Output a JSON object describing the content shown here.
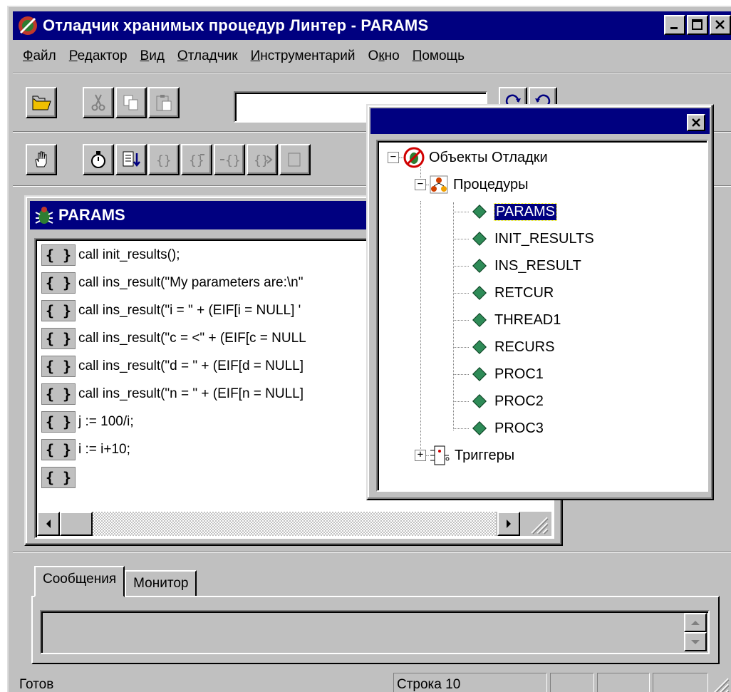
{
  "window": {
    "title": "Отладчик хранимых процедур Линтер - PARAMS",
    "minimize_label": "_",
    "maximize_label": "□",
    "close_label": "×"
  },
  "menu": [
    {
      "label": "Файл",
      "hotkey": "Ф",
      "rest": "айл"
    },
    {
      "label": "Редактор",
      "hotkey": "Р",
      "rest": "едактор"
    },
    {
      "label": "Вид",
      "hotkey": "В",
      "rest": "ид"
    },
    {
      "label": "Отладчик",
      "hotkey": "О",
      "rest": "тладчик"
    },
    {
      "label": "Инструментарий",
      "hotkey": "И",
      "rest": "нструментарий"
    },
    {
      "label": "Окно",
      "pre": "О",
      "hotkey": "к",
      "rest": "но"
    },
    {
      "label": "Помощь",
      "hotkey": "П",
      "rest": "омощь"
    }
  ],
  "toolbar": {
    "combo_value": "",
    "row1_icons": [
      "open-folder-icon",
      "cut-icon",
      "copy-icon",
      "paste-icon",
      "redo-icon",
      "undo-icon"
    ],
    "row2_icons": [
      "hand-icon",
      "stopwatch-icon",
      "list-down-icon",
      "step-into-icon",
      "step-over-icon",
      "step-out-icon",
      "run-to-cursor-icon"
    ]
  },
  "editor": {
    "title": "PARAMS",
    "brace_label": "{ }",
    "lines": [
      "call init_results();",
      "call ins_result(\"My parameters are:\\n\"",
      "call ins_result(\"i = \" + (EIF[i = NULL] '",
      "call ins_result(\"c = <\" + (EIF[c = NULL",
      "call ins_result(\"d = \" + (EIF[d = NULL]",
      "call ins_result(\"n = \" + (EIF[n = NULL]",
      "j := 100/i;",
      "i := i+10;"
    ]
  },
  "tree": {
    "root_label": "Объекты Отладки",
    "procedures_label": "Процедуры",
    "triggers_label": "Триггеры",
    "procedures": [
      "PARAMS",
      "INIT_RESULTS",
      "INS_RESULT",
      "RETCUR",
      "THREAD1",
      "RECURS",
      "PROC1",
      "PROC2",
      "PROC3"
    ],
    "selected": "PARAMS",
    "close_label": "×"
  },
  "bottom": {
    "tabs": [
      "Сообщения",
      "Монитор"
    ],
    "active_tab": "Сообщения"
  },
  "status": {
    "left": "Готов",
    "line": "Строка 10"
  }
}
